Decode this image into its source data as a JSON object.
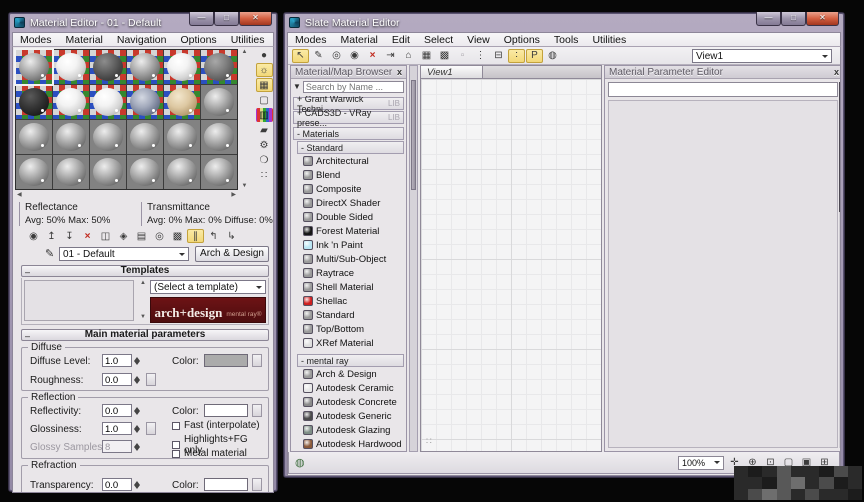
{
  "left_window": {
    "title": "Material Editor - 01 - Default",
    "menus": [
      {
        "label": "Modes"
      },
      {
        "label": "Material"
      },
      {
        "label": "Navigation"
      },
      {
        "label": "Options"
      },
      {
        "label": "Utilities"
      }
    ],
    "slots": [
      {
        "bg": "checker",
        "sphere": "s-gray",
        "sel": "selected"
      },
      {
        "bg": "checker",
        "sphere": "s-white"
      },
      {
        "bg": "checker",
        "sphere": "s-dark"
      },
      {
        "bg": "checker",
        "sphere": "s-gray"
      },
      {
        "bg": "checker",
        "sphere": "s-white"
      },
      {
        "bg": "checker",
        "sphere": "s-darkgray"
      },
      {
        "bg": "checker",
        "sphere": "s-scribble"
      },
      {
        "bg": "checker",
        "sphere": "s-white"
      },
      {
        "bg": "checker",
        "sphere": "s-white"
      },
      {
        "bg": "checker",
        "sphere": "s-galaxy"
      },
      {
        "bg": "checker",
        "sphere": "s-tan"
      },
      {
        "bg": "plain",
        "sphere": "s-gray"
      },
      {
        "bg": "plain",
        "sphere": "s-gray"
      },
      {
        "bg": "plain",
        "sphere": "s-gray"
      },
      {
        "bg": "plain",
        "sphere": "s-gray"
      },
      {
        "bg": "plain",
        "sphere": "s-gray"
      },
      {
        "bg": "plain",
        "sphere": "s-gray"
      },
      {
        "bg": "plain",
        "sphere": "s-gray"
      },
      {
        "bg": "plain",
        "sphere": "s-gray"
      },
      {
        "bg": "plain",
        "sphere": "s-gray"
      },
      {
        "bg": "plain",
        "sphere": "s-gray"
      },
      {
        "bg": "plain",
        "sphere": "s-gray"
      },
      {
        "bg": "plain",
        "sphere": "s-gray"
      },
      {
        "bg": "plain",
        "sphere": "s-gray"
      }
    ],
    "side_icons": [
      {
        "name": "sample-type-icon",
        "glyph": "●"
      },
      {
        "name": "backlight-icon",
        "glyph": "☼",
        "cls": "hl"
      },
      {
        "name": "background-icon",
        "glyph": "▦",
        "cls": "hl"
      },
      {
        "name": "sample-uv-tiling-icon",
        "glyph": "▢"
      },
      {
        "name": "video-color-check-icon",
        "glyph": "▥",
        "cls": "rainbow"
      },
      {
        "name": "make-preview-icon",
        "glyph": "▰"
      },
      {
        "name": "options-icon",
        "glyph": "⚙"
      },
      {
        "name": "select-by-material-icon",
        "glyph": "❍"
      },
      {
        "name": "material-map-navigator-icon",
        "glyph": "∷"
      }
    ],
    "reflectance": {
      "label": "Reflectance",
      "value": "Avg: 50% Max: 50%"
    },
    "transmittance": {
      "label": "Transmittance",
      "value": "Avg:  0% Max:  0% Diffuse:  0%"
    },
    "tool_icons": [
      {
        "name": "get-material-icon",
        "glyph": "◉"
      },
      {
        "name": "put-material-to-scene-icon",
        "glyph": "↥"
      },
      {
        "name": "assign-material-to-selection-icon",
        "glyph": "↧"
      },
      {
        "name": "reset-material-icon",
        "glyph": "×",
        "cls": "red"
      },
      {
        "name": "make-material-copy-icon",
        "glyph": "◫"
      },
      {
        "name": "make-unique-icon",
        "glyph": "◈"
      },
      {
        "name": "put-to-library-icon",
        "glyph": "▤"
      },
      {
        "name": "material-id-channel-icon",
        "glyph": "◎"
      },
      {
        "name": "show-map-in-viewport-icon",
        "glyph": "▩"
      },
      {
        "name": "show-end-result-icon",
        "glyph": "∥",
        "cls": "hl"
      },
      {
        "name": "go-to-parent-icon",
        "glyph": "↰"
      },
      {
        "name": "go-forward-to-sibling-icon",
        "glyph": "↳"
      }
    ],
    "material_name": "01 - Default",
    "type_button": "Arch & Design",
    "templates": {
      "header": "Templates",
      "select_placeholder": "(Select a template)",
      "banner_title": "arch+design",
      "banner_sub": "mental ray®"
    },
    "main_params": {
      "header": "Main material parameters",
      "diffuse": {
        "legend": "Diffuse",
        "diffuse_level_label": "Diffuse Level:",
        "diffuse_level": "1.0",
        "color_label": "Color:",
        "roughness_label": "Roughness:",
        "roughness": "0.0",
        "color_hex": "#ababab"
      },
      "reflection": {
        "legend": "Reflection",
        "reflectivity_label": "Reflectivity:",
        "reflectivity": "0.0",
        "color_label": "Color:",
        "color_hex": "#ffffff",
        "glossiness_label": "Glossiness:",
        "glossiness": "1.0",
        "glossy_samples_label": "Glossy Samples:",
        "glossy_samples": "8",
        "checkbox_fast": "Fast (interpolate)",
        "checkbox_highlights": "Highlights+FG only",
        "checkbox_metal": "Metal material"
      },
      "refraction": {
        "legend": "Refraction",
        "transparency_label": "Transparency:",
        "transparency": "0.0",
        "color_label": "Color:",
        "color_hex": "#ffffff"
      }
    }
  },
  "right_window": {
    "title": "Slate Material Editor",
    "menus": [
      {
        "label": "Modes"
      },
      {
        "label": "Material"
      },
      {
        "label": "Edit"
      },
      {
        "label": "Select"
      },
      {
        "label": "View"
      },
      {
        "label": "Options"
      },
      {
        "label": "Tools"
      },
      {
        "label": "Utilities"
      }
    ],
    "toolbar_icons": [
      {
        "name": "select-tool-icon",
        "glyph": "↖",
        "cls": "hl"
      },
      {
        "name": "pick-material-from-object-icon",
        "glyph": "✎"
      },
      {
        "name": "put-material-to-scene-icon",
        "glyph": "◎"
      },
      {
        "name": "assign-material-to-selection-icon",
        "glyph": "◉"
      },
      {
        "name": "delete-selected-icon",
        "glyph": "×",
        "cls": "red"
      },
      {
        "name": "move-children-icon",
        "glyph": "⇥"
      },
      {
        "name": "hide-unused-nodeslots-icon",
        "glyph": "⌂"
      },
      {
        "name": "show-shaded-material-in-viewport-icon",
        "glyph": "▦"
      },
      {
        "name": "show-realistic-material-in-viewport-icon",
        "glyph": "▩"
      },
      {
        "name": "show-end-result-icon",
        "glyph": "▫",
        "cls": "dis"
      },
      {
        "name": "layout-all-vertical-icon",
        "glyph": "⋮"
      },
      {
        "name": "layout-children-icon",
        "glyph": "⊟"
      },
      {
        "name": "show-connections-icon",
        "glyph": "∶",
        "cls": "hl"
      },
      {
        "name": "parameter-editor-toggle-icon",
        "glyph": "P",
        "cls": "hl"
      },
      {
        "name": "select-by-material-icon",
        "glyph": "◍"
      }
    ],
    "view_dropdown": "View1",
    "browser": {
      "header": "Material/Map Browser",
      "close": "x",
      "search_placeholder": "Search by Name ...",
      "libs": [
        {
          "label": "+ Grant Warwick Techni...",
          "tag": "LIB"
        },
        {
          "label": "+ CADS3D - VRay prese...",
          "tag": "LIB"
        }
      ],
      "materials_header": "- Materials",
      "standard_header": "- Standard",
      "standard_items": [
        {
          "name": "Architectural",
          "color": "#9a9a9a"
        },
        {
          "name": "Blend",
          "color": "#9a9a9a"
        },
        {
          "name": "Composite",
          "color": "#9a9a9a"
        },
        {
          "name": "DirectX Shader",
          "color": "#9a9a9a"
        },
        {
          "name": "Double Sided",
          "color": "#9a9a9a"
        },
        {
          "name": "Forest Material",
          "color": "#161616"
        },
        {
          "name": "Ink 'n Paint",
          "color": "#b9e5f3"
        },
        {
          "name": "Multi/Sub-Object",
          "color": "#9a9a9a"
        },
        {
          "name": "Raytrace",
          "color": "#9a9a9a"
        },
        {
          "name": "Shell Material",
          "color": "#9a9a9a"
        },
        {
          "name": "Shellac",
          "color": "#ce1f1f"
        },
        {
          "name": "Standard",
          "color": "#9a9a9a"
        },
        {
          "name": "Top/Bottom",
          "color": "#9a9a9a"
        },
        {
          "name": "XRef Material",
          "color": "#dedede"
        }
      ],
      "mentalray_header": "- mental ray",
      "mentalray_items": [
        {
          "name": "Arch & Design",
          "color": "#9a9a9a"
        },
        {
          "name": "Autodesk Ceramic",
          "color": "#e6e6e6"
        },
        {
          "name": "Autodesk Concrete",
          "color": "#8a8a8a"
        },
        {
          "name": "Autodesk Generic",
          "color": "#4a4a4a"
        },
        {
          "name": "Autodesk Glazing",
          "color": "#7d8d85"
        },
        {
          "name": "Autodesk Hardwood",
          "color": "#8a5a3a"
        }
      ]
    },
    "view_tab": "View1",
    "view_nav_glyph": "∷",
    "param_editor": {
      "header": "Material Parameter Editor",
      "close": "x"
    },
    "statusbar": {
      "left_icon_glyph": "◍",
      "zoom": "100%",
      "icons": [
        {
          "name": "pan-icon",
          "glyph": "✛"
        },
        {
          "name": "zoom-icon",
          "glyph": "⊕"
        },
        {
          "name": "zoom-region-icon",
          "glyph": "⊡"
        },
        {
          "name": "zoom-extents-icon",
          "glyph": "▢"
        },
        {
          "name": "zoom-extents-selected-icon",
          "glyph": "▣"
        },
        {
          "name": "pan-to-selected-icon",
          "glyph": "⊞"
        }
      ]
    }
  },
  "window_controls": {
    "minimize": "—",
    "maximize": "□",
    "close": "✕"
  }
}
